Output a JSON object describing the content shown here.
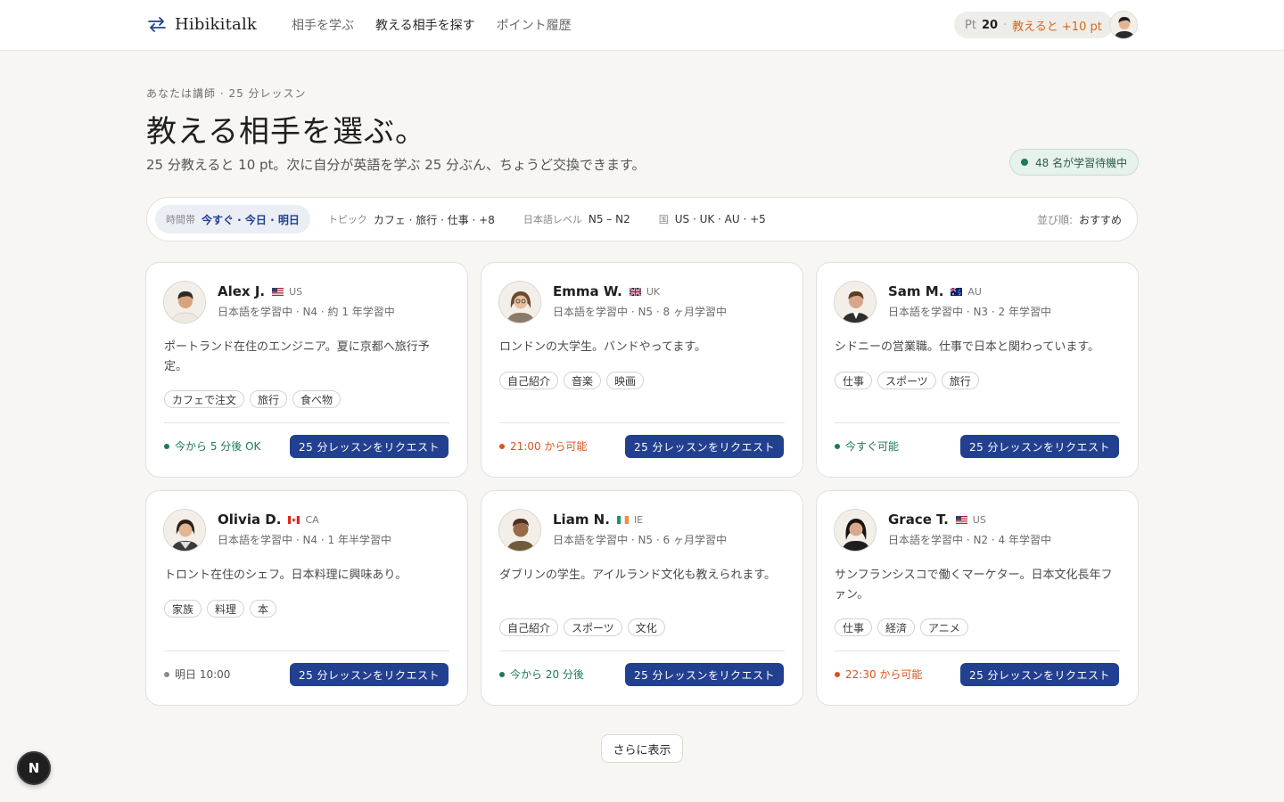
{
  "header": {
    "logo": "Hibikitalk",
    "nav": [
      "相手を学ぶ",
      "教える相手を探す",
      "ポイント履歴"
    ],
    "points_label": "Pt",
    "points_value": "20",
    "points_separator": "·",
    "points_earn": "教えると +10 pt"
  },
  "hero": {
    "eyebrow": "あなたは講師 · 25 分レッスン",
    "title": "教える相手を選ぶ。",
    "subtitle": "25 分教えると 10 pt。次に自分が英語を学ぶ 25 分ぶん、ちょうど交換できます。",
    "waiting": "48 名が学習待機中"
  },
  "filters": {
    "chips": [
      {
        "label": "時間帯",
        "value": "今すぐ · 今日 · 明日"
      },
      {
        "label": "トピック",
        "value": "カフェ · 旅行 · 仕事 · +8"
      },
      {
        "label": "日本語レベル",
        "value": "N5 – N2"
      },
      {
        "label": "国",
        "value": "US · UK · AU · +5"
      }
    ],
    "sort_label": "並び順:",
    "sort_value": "おすすめ"
  },
  "request_label": "25 分レッスンをリクエスト",
  "cards": [
    {
      "name": "Alex J.",
      "country": "US",
      "meta": "日本語を学習中 · N4 · 約 1 年学習中",
      "bio": "ポートランド在住のエンジニア。夏に京都へ旅行予定。",
      "tags": [
        "カフェで注文",
        "旅行",
        "食べ物"
      ],
      "availability": "今から 5 分後 OK",
      "status_color": "#1e7a55"
    },
    {
      "name": "Emma W.",
      "country": "UK",
      "meta": "日本語を学習中 · N5 · 8 ヶ月学習中",
      "bio": "ロンドンの大学生。バンドやってます。",
      "tags": [
        "自己紹介",
        "音楽",
        "映画"
      ],
      "availability": "21:00 から可能",
      "status_color": "#d9541e"
    },
    {
      "name": "Sam M.",
      "country": "AU",
      "meta": "日本語を学習中 · N3 · 2 年学習中",
      "bio": "シドニーの営業職。仕事で日本と関わっています。",
      "tags": [
        "仕事",
        "スポーツ",
        "旅行"
      ],
      "availability": "今すぐ可能",
      "status_color": "#1e7a55"
    },
    {
      "name": "Olivia D.",
      "country": "CA",
      "meta": "日本語を学習中 · N4 · 1 年半学習中",
      "bio": "トロント在住のシェフ。日本料理に興味あり。",
      "tags": [
        "家族",
        "料理",
        "本"
      ],
      "availability": "明日 10:00",
      "status_color": "#8c8c8c"
    },
    {
      "name": "Liam N.",
      "country": "IE",
      "meta": "日本語を学習中 · N5 · 6 ヶ月学習中",
      "bio": "ダブリンの学生。アイルランド文化も教えられます。",
      "tags": [
        "自己紹介",
        "スポーツ",
        "文化"
      ],
      "availability": "今から 20 分後",
      "status_color": "#1e7a55"
    },
    {
      "name": "Grace T.",
      "country": "US",
      "meta": "日本語を学習中 · N2 · 4 年学習中",
      "bio": "サンフランシスコで働くマーケター。日本文化長年ファン。",
      "tags": [
        "仕事",
        "経済",
        "アニメ"
      ],
      "availability": "22:30 から可能",
      "status_color": "#d9541e"
    }
  ],
  "more_label": "さらに表示",
  "badge": "N"
}
